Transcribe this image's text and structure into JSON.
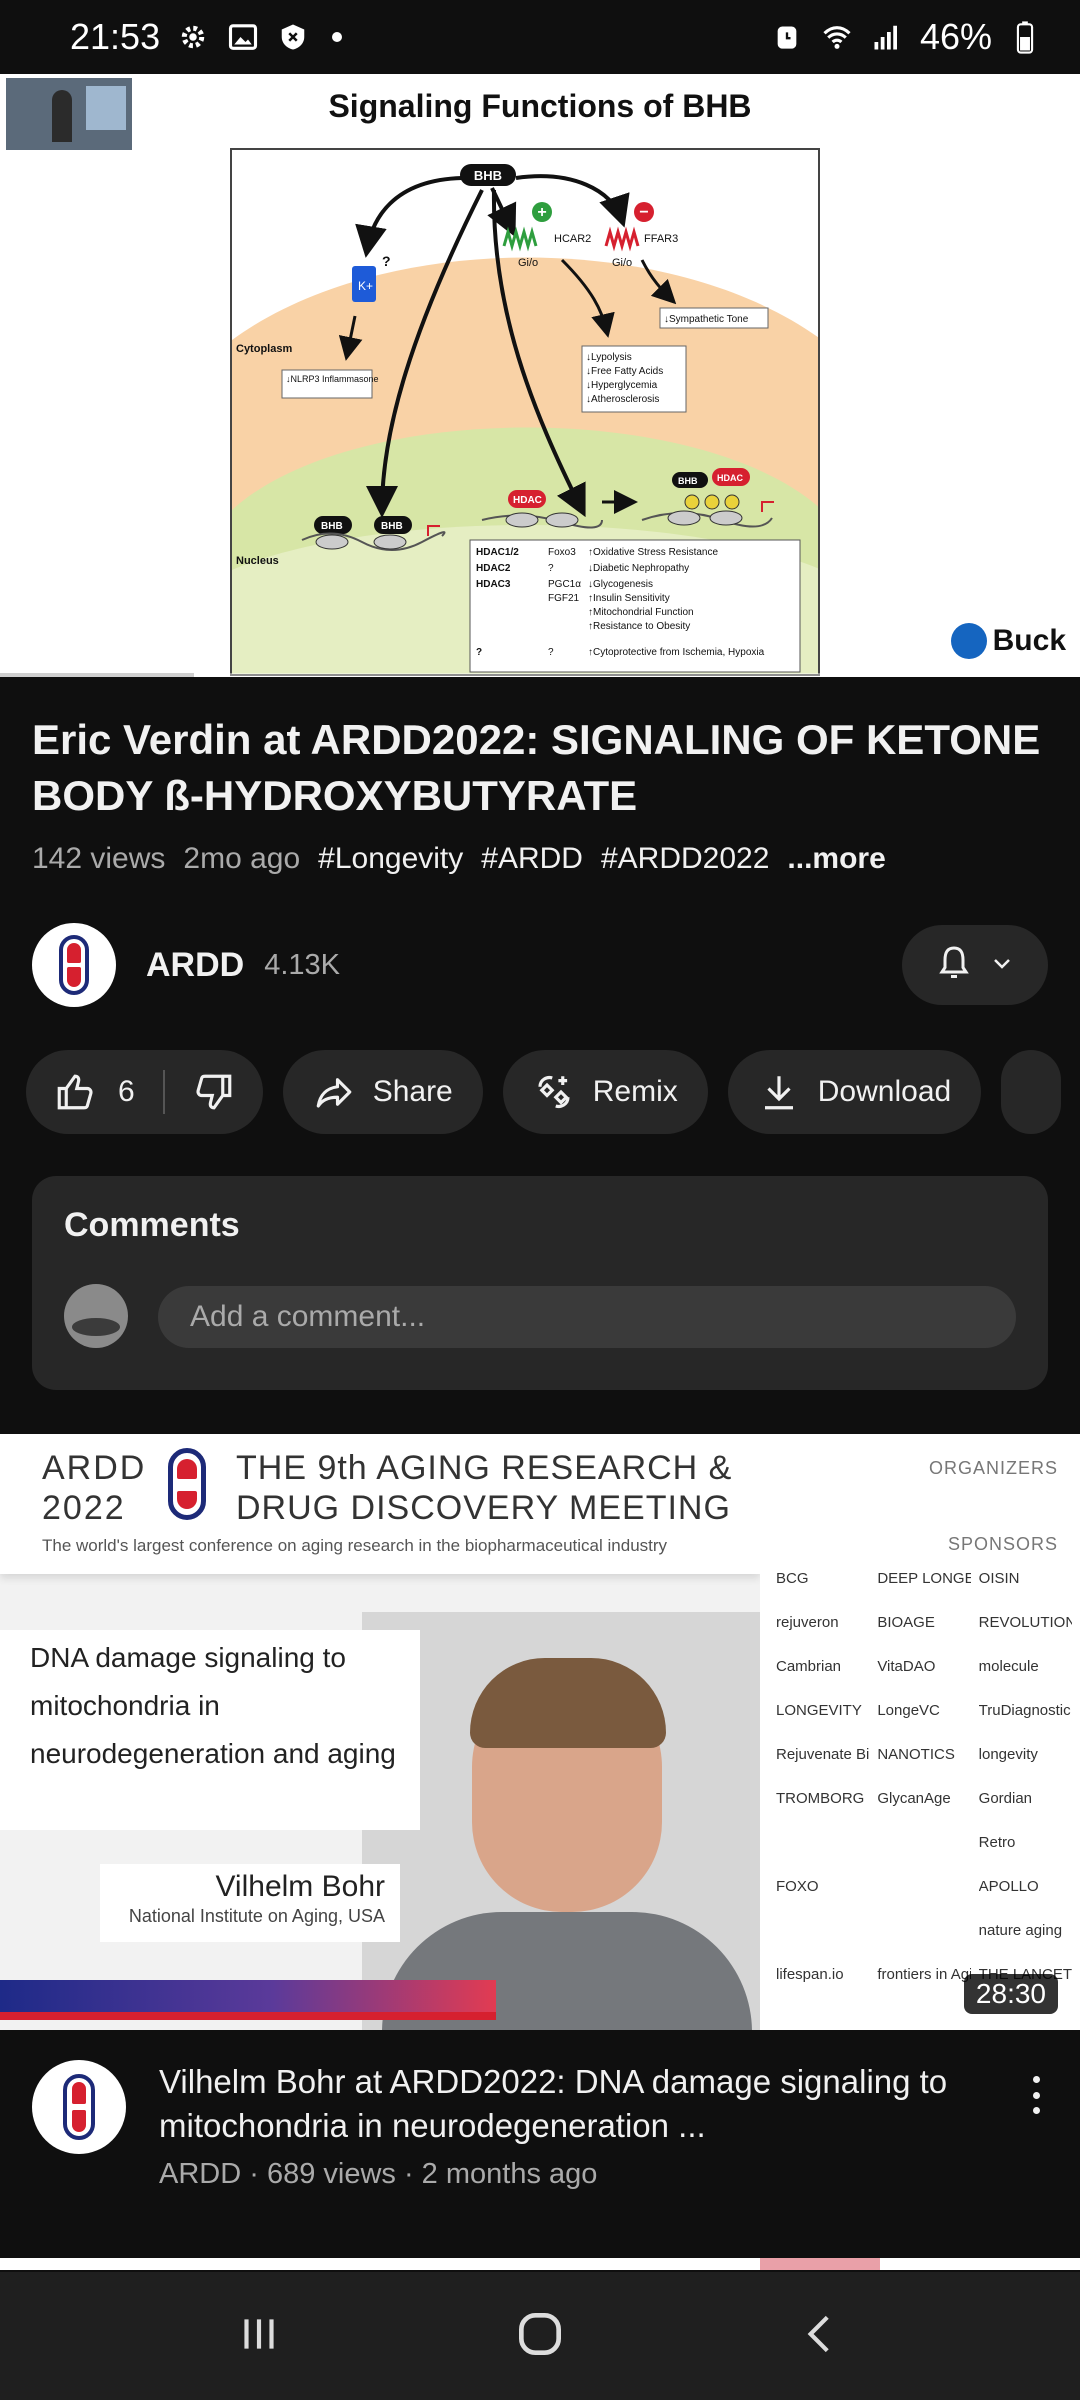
{
  "status_bar": {
    "time": "21:53",
    "battery": "46%",
    "left_icons": [
      "gear-icon",
      "image-icon",
      "shield-icon"
    ],
    "right_icons": [
      "alarm-icon",
      "wifi-icon",
      "signal-icon",
      "battery-icon"
    ]
  },
  "player": {
    "slide_title": "Signaling Functions of BHB",
    "logo_text": "Buck",
    "progress": 0.18,
    "diagram_labels": {
      "bhb": "BHB",
      "hcar2": "HCAR2",
      "ffar3": "FFAR3",
      "gio_1": "Gi/o",
      "gio_2": "Gi/o",
      "k_ion": "K+",
      "q_mark": "?",
      "plus": "+",
      "minus": "−",
      "sympathetic": "↓Sympathetic Tone",
      "cytoplasm": "Cytoplasm",
      "nlrp3": "↓NLRP3 Inflammasone",
      "lipolysis": [
        "↓Lypolysis",
        "↓Free Fatty Acids",
        "↓Hyperglycemia",
        "↓Atherosclerosis"
      ],
      "nucleus": "Nucleus",
      "hdac": "HDAC",
      "hdac_table": [
        [
          "HDAC1/2",
          "Foxo3",
          "↑Oxidative Stress Resistance"
        ],
        [
          "HDAC2",
          "?",
          "↓Diabetic Nephropathy"
        ],
        [
          "HDAC3",
          "PGC1α",
          "↓Glycogenesis"
        ],
        [
          "",
          "FGF21",
          "↑Insulin Sensitivity"
        ],
        [
          "",
          "",
          "↑Mitochondrial Function"
        ],
        [
          "",
          "",
          "↑Resistance to Obesity"
        ],
        [
          "?",
          "?",
          "↑Cytoprotective from Ischemia, Hypoxia"
        ]
      ]
    }
  },
  "video": {
    "title": "Eric Verdin at ARDD2022: SIGNALING OF KETONE BODY ß-HYDROXYBUTYRATE",
    "views": "142 views",
    "age": "2mo ago",
    "tags": [
      "#Longevity",
      "#ARDD",
      "#ARDD2022"
    ],
    "more": "...more"
  },
  "channel": {
    "name": "ARDD",
    "subscribers": "4.13K"
  },
  "actions": {
    "like_count": "6",
    "share": "Share",
    "remix": "Remix",
    "download": "Download"
  },
  "comments": {
    "title": "Comments",
    "placeholder": "Add a comment..."
  },
  "next_video": {
    "thumb": {
      "ardd": "ARDD",
      "year": "2022",
      "meeting_line1": "THE 9th AGING RESEARCH &",
      "meeting_line2": "DRUG DISCOVERY MEETING",
      "subtitle": "The world's largest conference on aging research in the biopharmaceutical industry",
      "talk_title": "DNA damage signaling to mitochondria in neurodegeneration and aging",
      "speaker": "Vilhelm Bohr",
      "affiliation": "National Institute on Aging, USA",
      "organizers": "ORGANIZERS",
      "sponsors": "SPONSORS",
      "sponsor_names": [
        "BCG",
        "DEEP LONGEVITY",
        "OISIN",
        "rejuveron",
        "BIOAGE",
        "REVOLUTION",
        "Cambrian",
        "VitaDAO",
        "molecule",
        "LONGEVITY",
        "LongeVC",
        "TruDiagnostic",
        "Rejuvenate Bio",
        "NANOTICS",
        "longevity",
        "TROMBORG",
        "GlycanAge",
        "Gordian",
        "",
        "",
        "Retro",
        "FOXO",
        "",
        "APOLLO",
        "",
        "",
        "nature aging",
        "lifespan.io",
        "frontiers in Aging",
        "THE LANCET"
      ],
      "duration": "28:30"
    },
    "title": "Vilhelm Bohr at ARDD2022: DNA damage signaling to mitochondria in neurodegeneration ...",
    "channel": "ARDD",
    "views": "689 views",
    "age": "2 months ago",
    "meta": "ARDD · 689 views · 2 months ago"
  },
  "nav": [
    "recents-icon",
    "home-icon",
    "back-icon"
  ]
}
